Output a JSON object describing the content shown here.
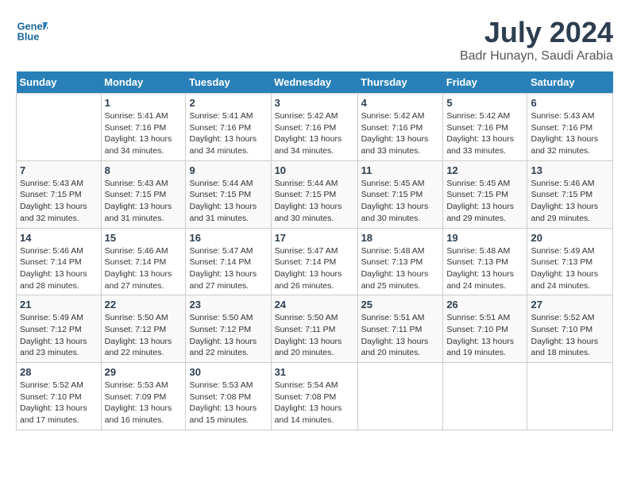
{
  "header": {
    "logo_line1": "General",
    "logo_line2": "Blue",
    "title": "July 2024",
    "subtitle": "Badr Hunayn, Saudi Arabia"
  },
  "weekdays": [
    "Sunday",
    "Monday",
    "Tuesday",
    "Wednesday",
    "Thursday",
    "Friday",
    "Saturday"
  ],
  "weeks": [
    [
      {
        "day": "",
        "sunrise": "",
        "sunset": "",
        "daylight": ""
      },
      {
        "day": "1",
        "sunrise": "Sunrise: 5:41 AM",
        "sunset": "Sunset: 7:16 PM",
        "daylight": "Daylight: 13 hours and 34 minutes."
      },
      {
        "day": "2",
        "sunrise": "Sunrise: 5:41 AM",
        "sunset": "Sunset: 7:16 PM",
        "daylight": "Daylight: 13 hours and 34 minutes."
      },
      {
        "day": "3",
        "sunrise": "Sunrise: 5:42 AM",
        "sunset": "Sunset: 7:16 PM",
        "daylight": "Daylight: 13 hours and 34 minutes."
      },
      {
        "day": "4",
        "sunrise": "Sunrise: 5:42 AM",
        "sunset": "Sunset: 7:16 PM",
        "daylight": "Daylight: 13 hours and 33 minutes."
      },
      {
        "day": "5",
        "sunrise": "Sunrise: 5:42 AM",
        "sunset": "Sunset: 7:16 PM",
        "daylight": "Daylight: 13 hours and 33 minutes."
      },
      {
        "day": "6",
        "sunrise": "Sunrise: 5:43 AM",
        "sunset": "Sunset: 7:16 PM",
        "daylight": "Daylight: 13 hours and 32 minutes."
      }
    ],
    [
      {
        "day": "7",
        "sunrise": "Sunrise: 5:43 AM",
        "sunset": "Sunset: 7:15 PM",
        "daylight": "Daylight: 13 hours and 32 minutes."
      },
      {
        "day": "8",
        "sunrise": "Sunrise: 5:43 AM",
        "sunset": "Sunset: 7:15 PM",
        "daylight": "Daylight: 13 hours and 31 minutes."
      },
      {
        "day": "9",
        "sunrise": "Sunrise: 5:44 AM",
        "sunset": "Sunset: 7:15 PM",
        "daylight": "Daylight: 13 hours and 31 minutes."
      },
      {
        "day": "10",
        "sunrise": "Sunrise: 5:44 AM",
        "sunset": "Sunset: 7:15 PM",
        "daylight": "Daylight: 13 hours and 30 minutes."
      },
      {
        "day": "11",
        "sunrise": "Sunrise: 5:45 AM",
        "sunset": "Sunset: 7:15 PM",
        "daylight": "Daylight: 13 hours and 30 minutes."
      },
      {
        "day": "12",
        "sunrise": "Sunrise: 5:45 AM",
        "sunset": "Sunset: 7:15 PM",
        "daylight": "Daylight: 13 hours and 29 minutes."
      },
      {
        "day": "13",
        "sunrise": "Sunrise: 5:46 AM",
        "sunset": "Sunset: 7:15 PM",
        "daylight": "Daylight: 13 hours and 29 minutes."
      }
    ],
    [
      {
        "day": "14",
        "sunrise": "Sunrise: 5:46 AM",
        "sunset": "Sunset: 7:14 PM",
        "daylight": "Daylight: 13 hours and 28 minutes."
      },
      {
        "day": "15",
        "sunrise": "Sunrise: 5:46 AM",
        "sunset": "Sunset: 7:14 PM",
        "daylight": "Daylight: 13 hours and 27 minutes."
      },
      {
        "day": "16",
        "sunrise": "Sunrise: 5:47 AM",
        "sunset": "Sunset: 7:14 PM",
        "daylight": "Daylight: 13 hours and 27 minutes."
      },
      {
        "day": "17",
        "sunrise": "Sunrise: 5:47 AM",
        "sunset": "Sunset: 7:14 PM",
        "daylight": "Daylight: 13 hours and 26 minutes."
      },
      {
        "day": "18",
        "sunrise": "Sunrise: 5:48 AM",
        "sunset": "Sunset: 7:13 PM",
        "daylight": "Daylight: 13 hours and 25 minutes."
      },
      {
        "day": "19",
        "sunrise": "Sunrise: 5:48 AM",
        "sunset": "Sunset: 7:13 PM",
        "daylight": "Daylight: 13 hours and 24 minutes."
      },
      {
        "day": "20",
        "sunrise": "Sunrise: 5:49 AM",
        "sunset": "Sunset: 7:13 PM",
        "daylight": "Daylight: 13 hours and 24 minutes."
      }
    ],
    [
      {
        "day": "21",
        "sunrise": "Sunrise: 5:49 AM",
        "sunset": "Sunset: 7:12 PM",
        "daylight": "Daylight: 13 hours and 23 minutes."
      },
      {
        "day": "22",
        "sunrise": "Sunrise: 5:50 AM",
        "sunset": "Sunset: 7:12 PM",
        "daylight": "Daylight: 13 hours and 22 minutes."
      },
      {
        "day": "23",
        "sunrise": "Sunrise: 5:50 AM",
        "sunset": "Sunset: 7:12 PM",
        "daylight": "Daylight: 13 hours and 22 minutes."
      },
      {
        "day": "24",
        "sunrise": "Sunrise: 5:50 AM",
        "sunset": "Sunset: 7:11 PM",
        "daylight": "Daylight: 13 hours and 20 minutes."
      },
      {
        "day": "25",
        "sunrise": "Sunrise: 5:51 AM",
        "sunset": "Sunset: 7:11 PM",
        "daylight": "Daylight: 13 hours and 20 minutes."
      },
      {
        "day": "26",
        "sunrise": "Sunrise: 5:51 AM",
        "sunset": "Sunset: 7:10 PM",
        "daylight": "Daylight: 13 hours and 19 minutes."
      },
      {
        "day": "27",
        "sunrise": "Sunrise: 5:52 AM",
        "sunset": "Sunset: 7:10 PM",
        "daylight": "Daylight: 13 hours and 18 minutes."
      }
    ],
    [
      {
        "day": "28",
        "sunrise": "Sunrise: 5:52 AM",
        "sunset": "Sunset: 7:10 PM",
        "daylight": "Daylight: 13 hours and 17 minutes."
      },
      {
        "day": "29",
        "sunrise": "Sunrise: 5:53 AM",
        "sunset": "Sunset: 7:09 PM",
        "daylight": "Daylight: 13 hours and 16 minutes."
      },
      {
        "day": "30",
        "sunrise": "Sunrise: 5:53 AM",
        "sunset": "Sunset: 7:08 PM",
        "daylight": "Daylight: 13 hours and 15 minutes."
      },
      {
        "day": "31",
        "sunrise": "Sunrise: 5:54 AM",
        "sunset": "Sunset: 7:08 PM",
        "daylight": "Daylight: 13 hours and 14 minutes."
      },
      {
        "day": "",
        "sunrise": "",
        "sunset": "",
        "daylight": ""
      },
      {
        "day": "",
        "sunrise": "",
        "sunset": "",
        "daylight": ""
      },
      {
        "day": "",
        "sunrise": "",
        "sunset": "",
        "daylight": ""
      }
    ]
  ]
}
